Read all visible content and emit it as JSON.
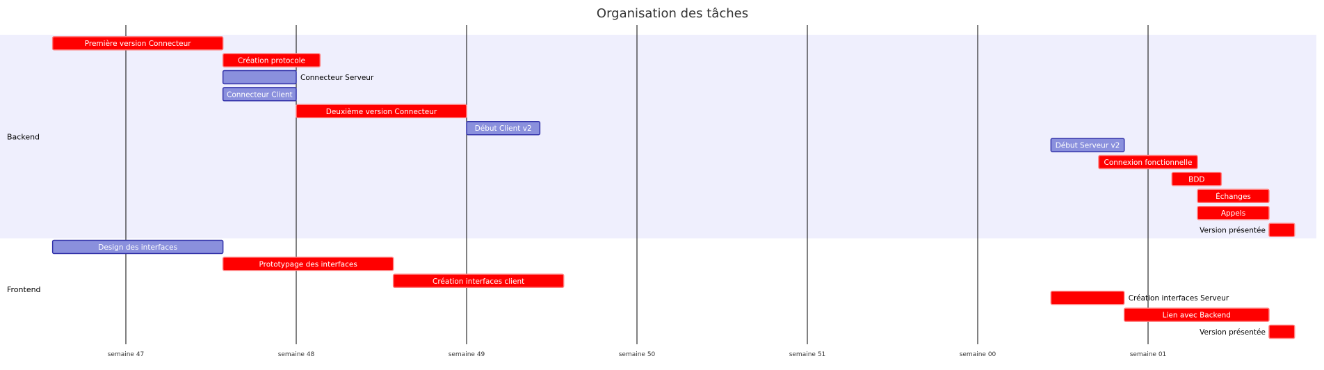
{
  "chart_data": {
    "type": "gantt",
    "title": "Organisation des tâches",
    "x_ticks": [
      "semaine 47",
      "semaine 48",
      "semaine 49",
      "semaine 50",
      "semaine 51",
      "semaine 00",
      "semaine 01"
    ],
    "x_range_weeks": [
      46.57,
      53.0
    ],
    "grid": true,
    "colors": {
      "done": "#ff0000",
      "done_border": "#ff8080",
      "active": "#8a90dd",
      "active_border": "#3333aa",
      "section_band": "#efeffd",
      "grid_line": "#000000"
    },
    "sections": [
      {
        "name": "Backend",
        "tasks": [
          {
            "name": "Première version Connecteur",
            "start": 46.57,
            "end": 47.57,
            "status": "done"
          },
          {
            "name": "Création protocole",
            "start": 47.57,
            "end": 48.14,
            "status": "done"
          },
          {
            "name": "Connecteur Serveur",
            "start": 47.57,
            "end": 48.0,
            "status": "active"
          },
          {
            "name": "Connecteur Client",
            "start": 47.57,
            "end": 48.0,
            "status": "active"
          },
          {
            "name": "Deuxième version Connecteur",
            "start": 48.0,
            "end": 49.0,
            "status": "done"
          },
          {
            "name": "Début Client v2",
            "start": 49.0,
            "end": 49.43,
            "status": "active"
          },
          {
            "name": "Début Serveur v2",
            "start": 52.43,
            "end": 52.86,
            "status": "active"
          },
          {
            "name": "Connexion fonctionnelle",
            "start": 52.71,
            "end": 53.29,
            "status": "done"
          },
          {
            "name": "BDD",
            "start": 53.14,
            "end": 53.43,
            "status": "done"
          },
          {
            "name": "Échanges",
            "start": 53.29,
            "end": 53.71,
            "status": "done"
          },
          {
            "name": "Appels",
            "start": 53.29,
            "end": 53.71,
            "status": "done"
          },
          {
            "name": "Version présentée",
            "start": 53.71,
            "end": 53.86,
            "status": "done"
          }
        ]
      },
      {
        "name": "Frontend",
        "tasks": [
          {
            "name": "Design des interfaces",
            "start": 46.57,
            "end": 47.57,
            "status": "active"
          },
          {
            "name": "Prototypage des interfaces",
            "start": 47.57,
            "end": 48.57,
            "status": "done"
          },
          {
            "name": "Création interfaces client",
            "start": 48.57,
            "end": 49.57,
            "status": "done"
          },
          {
            "name": "Création interfaces Serveur",
            "start": 52.43,
            "end": 52.86,
            "status": "done"
          },
          {
            "name": "Lien avec Backend",
            "start": 52.86,
            "end": 53.71,
            "status": "done"
          },
          {
            "name": "Version présentée",
            "start": 53.71,
            "end": 53.86,
            "status": "done"
          }
        ]
      }
    ]
  }
}
